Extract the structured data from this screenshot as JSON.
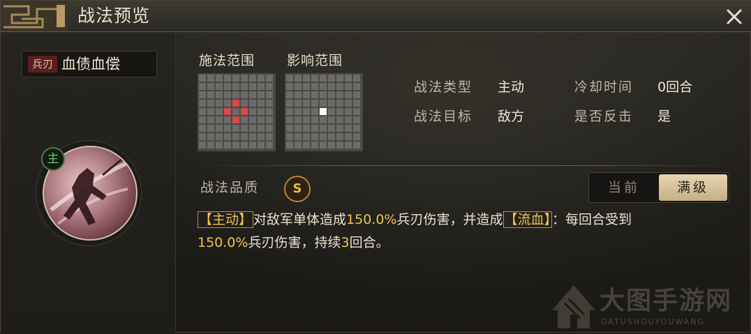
{
  "window": {
    "title": "战法预览"
  },
  "skill": {
    "type_tag": "兵刃",
    "name": "血债血偿",
    "active_badge": "主"
  },
  "grids": {
    "cast_range_label": "施法范围",
    "effect_range_label": "影响范围",
    "size": 9,
    "cast_highlight_cells": [
      [
        3,
        4
      ],
      [
        4,
        3
      ],
      [
        4,
        5
      ],
      [
        5,
        4
      ]
    ],
    "effect_highlight_cells": [
      [
        4,
        4
      ]
    ],
    "cast_highlight_color": "#d84a4a",
    "effect_highlight_color": "#ffffff"
  },
  "stats": {
    "type_label": "战法类型",
    "type_value": "主动",
    "cooldown_label": "冷却时间",
    "cooldown_value": "0回合",
    "target_label": "战法目标",
    "target_value": "敌方",
    "counter_label": "是否反击",
    "counter_value": "是"
  },
  "quality": {
    "label": "战法品质",
    "value": "S"
  },
  "level_toggle": {
    "current": "当前",
    "max": "满级",
    "selected": "max"
  },
  "description": {
    "tag1": "【主动】",
    "part1": "对敌军单体造成",
    "num1": "150.0%",
    "part2": "兵刃伤害，并造成",
    "tag2": "【流血】",
    "part3": "：每回合受到",
    "num2": "150.0%",
    "part4": "兵刃伤害，持续",
    "num3": "3",
    "part5": "回合。"
  },
  "watermark": {
    "name": "大图手游网",
    "sub": "DATUSHOUYOUWANG"
  },
  "colors": {
    "accent_gold": "#f0c44b",
    "active_green": "#5fcf5a",
    "tag_red": "#5a1f1f"
  }
}
